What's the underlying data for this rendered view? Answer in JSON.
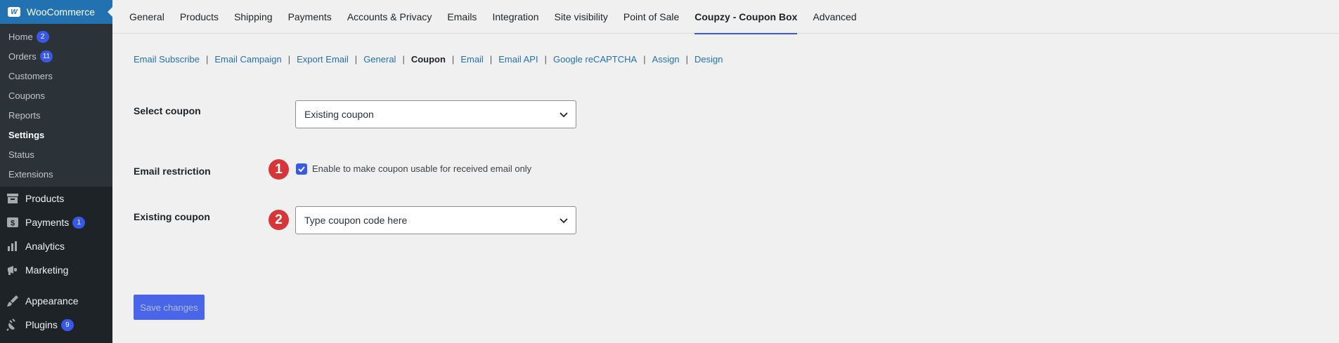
{
  "sidebar": {
    "woocommerce_label": "WooCommerce",
    "submenu": [
      {
        "label": "Home",
        "badge": "2"
      },
      {
        "label": "Orders",
        "badge": "11"
      },
      {
        "label": "Customers"
      },
      {
        "label": "Coupons"
      },
      {
        "label": "Reports"
      },
      {
        "label": "Settings"
      },
      {
        "label": "Status"
      },
      {
        "label": "Extensions"
      }
    ],
    "menu": [
      {
        "label": "Products"
      },
      {
        "label": "Payments",
        "badge": "1"
      },
      {
        "label": "Analytics"
      },
      {
        "label": "Marketing"
      },
      {
        "label": "Appearance"
      },
      {
        "label": "Plugins",
        "badge": "9"
      }
    ]
  },
  "tabs": [
    "General",
    "Products",
    "Shipping",
    "Payments",
    "Accounts & Privacy",
    "Emails",
    "Integration",
    "Site visibility",
    "Point of Sale",
    "Coupzy - Coupon Box",
    "Advanced"
  ],
  "active_tab": "Coupzy - Coupon Box",
  "sublinks": [
    "Email Subscribe",
    "Email Campaign",
    "Export Email",
    "General",
    "Coupon",
    "Email",
    "Email API",
    "Google reCAPTCHA",
    "Assign",
    "Design"
  ],
  "current_sublink": "Coupon",
  "form": {
    "select_coupon_label": "Select coupon",
    "select_coupon_value": "Existing coupon",
    "email_restriction_label": "Email restriction",
    "email_restriction_checkbox_label": "Enable to make coupon usable for received email only",
    "email_restriction_checked": true,
    "existing_coupon_label": "Existing coupon",
    "existing_coupon_placeholder": "Type coupon code here",
    "marker_1": "1",
    "marker_2": "2"
  },
  "save_button": "Save changes",
  "colors": {
    "accent": "#3858e9",
    "marker": "#d63638",
    "sidebar": "#1d2327"
  }
}
